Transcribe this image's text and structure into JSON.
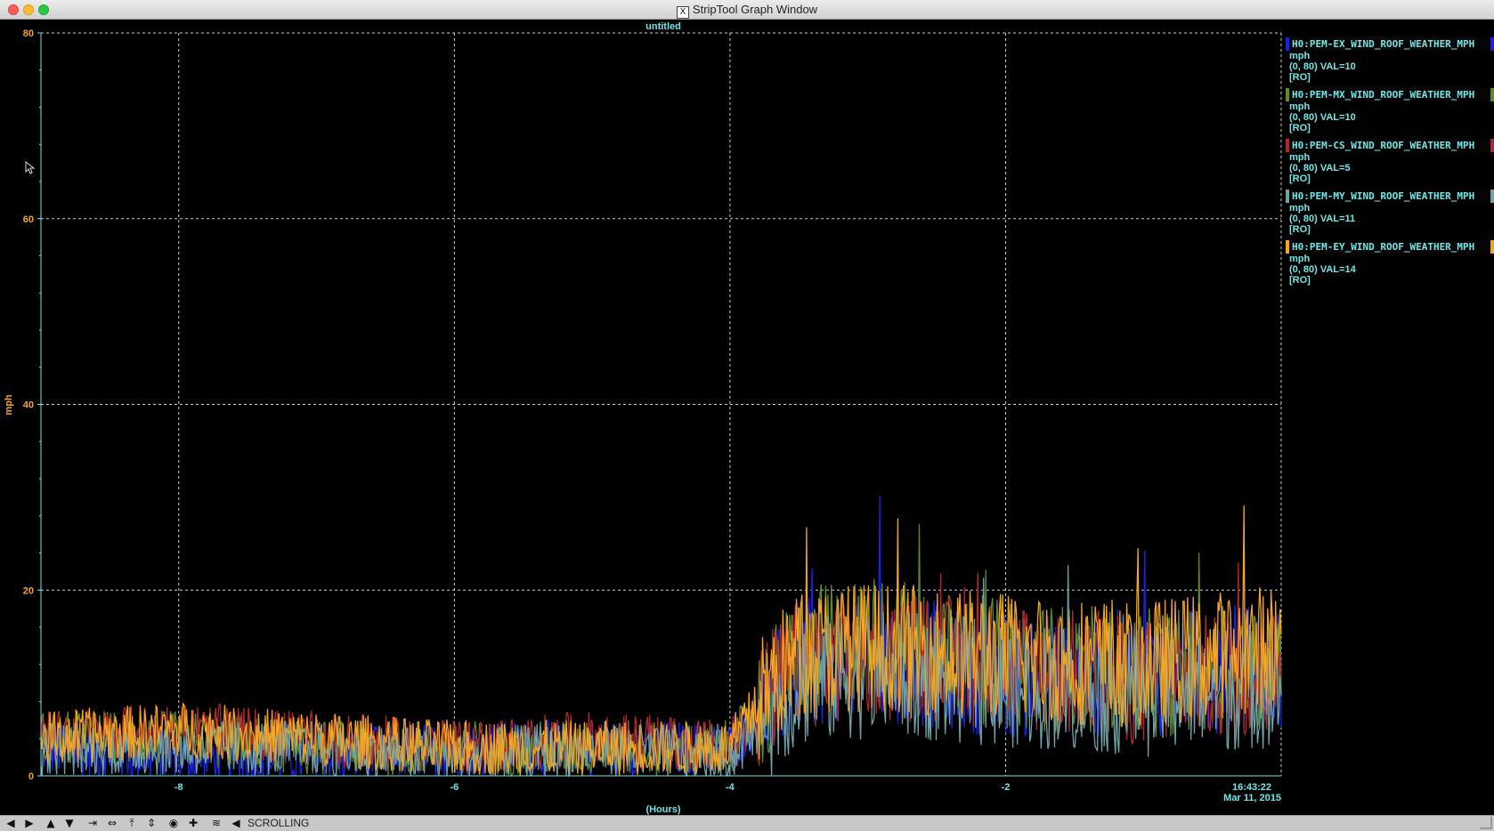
{
  "window": {
    "title": "StripTool Graph Window"
  },
  "chart_data": {
    "type": "line",
    "title": "untitled",
    "xlabel": "(Hours)",
    "ylabel": "mph",
    "xlim": [
      -9,
      -0.0
    ],
    "ylim": [
      0,
      80
    ],
    "x_ticks": [
      -8,
      -6,
      -4,
      -2
    ],
    "y_ticks": [
      0,
      20,
      40,
      60,
      80
    ],
    "grid": true,
    "timestamp": {
      "time": "16:43:22",
      "date": "Mar 11, 2015"
    },
    "series": [
      {
        "name": "H0:PEM-EX_WIND_ROOF_WEATHER_MPH",
        "units": "mph",
        "range": "(0, 80) VAL=10",
        "mode": "[RO]",
        "color": "#1a22e8",
        "profile": [
          [
            -9,
            3
          ],
          [
            -8,
            2
          ],
          [
            -7,
            2
          ],
          [
            -6,
            3
          ],
          [
            -5,
            3
          ],
          [
            -4,
            3
          ],
          [
            -3.7,
            8
          ],
          [
            -3.5,
            12
          ],
          [
            -3,
            13
          ],
          [
            -2,
            11
          ],
          [
            -1,
            11
          ],
          [
            0,
            12
          ]
        ]
      },
      {
        "name": "H0:PEM-MX_WIND_ROOF_WEATHER_MPH",
        "units": "mph",
        "range": "(0, 80) VAL=10",
        "mode": "[RO]",
        "color": "#5f8a2a",
        "profile": [
          [
            -9,
            4
          ],
          [
            -8,
            4
          ],
          [
            -7,
            3
          ],
          [
            -6,
            3
          ],
          [
            -5,
            3
          ],
          [
            -4,
            3
          ],
          [
            -3.7,
            9
          ],
          [
            -3.5,
            13
          ],
          [
            -3,
            15
          ],
          [
            -2,
            12
          ],
          [
            -1,
            11
          ],
          [
            0,
            12
          ]
        ]
      },
      {
        "name": "H0:PEM-CS_WIND_ROOF_WEATHER_MPH",
        "units": "mph",
        "range": "(0, 80) VAL=5",
        "mode": "[RO]",
        "color": "#b0292e",
        "profile": [
          [
            -9,
            4
          ],
          [
            -8,
            5
          ],
          [
            -7,
            4
          ],
          [
            -6,
            3
          ],
          [
            -5,
            4
          ],
          [
            -4,
            3
          ],
          [
            -3.7,
            9
          ],
          [
            -3.5,
            12
          ],
          [
            -3,
            13
          ],
          [
            -2,
            12
          ],
          [
            -1,
            10
          ],
          [
            0,
            11
          ]
        ]
      },
      {
        "name": "H0:PEM-MY_WIND_ROOF_WEATHER_MPH",
        "units": "mph",
        "range": "(0, 80) VAL=11",
        "mode": "[RO]",
        "color": "#6fa3a8",
        "profile": [
          [
            -9,
            3
          ],
          [
            -8,
            3
          ],
          [
            -7,
            3
          ],
          [
            -6,
            2
          ],
          [
            -5,
            3
          ],
          [
            -4,
            2
          ],
          [
            -3.7,
            7
          ],
          [
            -3.5,
            10
          ],
          [
            -3,
            11
          ],
          [
            -2,
            10
          ],
          [
            -1,
            9
          ],
          [
            0,
            10
          ]
        ]
      },
      {
        "name": "H0:PEM-EY_WIND_ROOF_WEATHER_MPH",
        "units": "mph",
        "range": "(0, 80) VAL=14",
        "mode": "[RO]",
        "color": "#f6a521",
        "profile": [
          [
            -9,
            4
          ],
          [
            -8,
            5
          ],
          [
            -7,
            4
          ],
          [
            -6,
            3
          ],
          [
            -5,
            3
          ],
          [
            -4,
            3
          ],
          [
            -3.7,
            10
          ],
          [
            -3.5,
            13
          ],
          [
            -3,
            14
          ],
          [
            -2,
            13
          ],
          [
            -1,
            12
          ],
          [
            0,
            14
          ]
        ]
      }
    ]
  },
  "toolbar": {
    "status": "SCROLLING",
    "buttons": [
      {
        "icon": "arrow-left-icon"
      },
      {
        "icon": "arrow-right-icon"
      },
      {
        "icon": "arrow-up-icon"
      },
      {
        "icon": "arrow-down-icon"
      },
      {
        "icon": "zoom-in-x-icon"
      },
      {
        "icon": "zoom-out-x-icon"
      },
      {
        "icon": "zoom-in-y-icon"
      },
      {
        "icon": "zoom-out-y-icon"
      },
      {
        "icon": "auto-scale-icon"
      },
      {
        "icon": "reset-icon"
      },
      {
        "icon": "pause-icon"
      },
      {
        "icon": "resume-icon"
      }
    ]
  }
}
